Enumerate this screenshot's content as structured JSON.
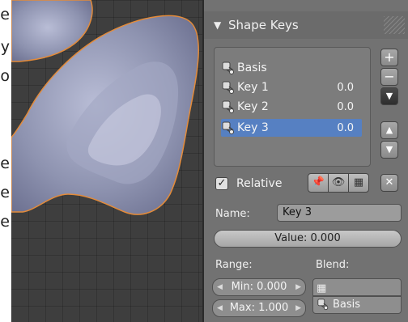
{
  "left_text": [
    "e",
    "y",
    "o",
    "e",
    "e",
    "e"
  ],
  "panel": {
    "header": {
      "title": "Shape Keys"
    },
    "shape_keys": [
      {
        "name": "Basis",
        "value": ""
      },
      {
        "name": "Key 1",
        "value": "0.0"
      },
      {
        "name": "Key 2",
        "value": "0.0"
      },
      {
        "name": "Key 3",
        "value": "0.0",
        "selected": true
      }
    ],
    "relative": {
      "label": "Relative",
      "checked": true
    },
    "name_field": {
      "label": "Name:",
      "value": "Key 3"
    },
    "value_field": {
      "text": "Value: 0.000"
    },
    "range": {
      "label": "Range:",
      "min": "Min: 0.000",
      "max": "Max: 1.000"
    },
    "blend": {
      "label": "Blend:",
      "relative_key": "Basis"
    }
  },
  "colors": {
    "selection": "#5680c2",
    "mesh_outline": "#e38b3a"
  }
}
